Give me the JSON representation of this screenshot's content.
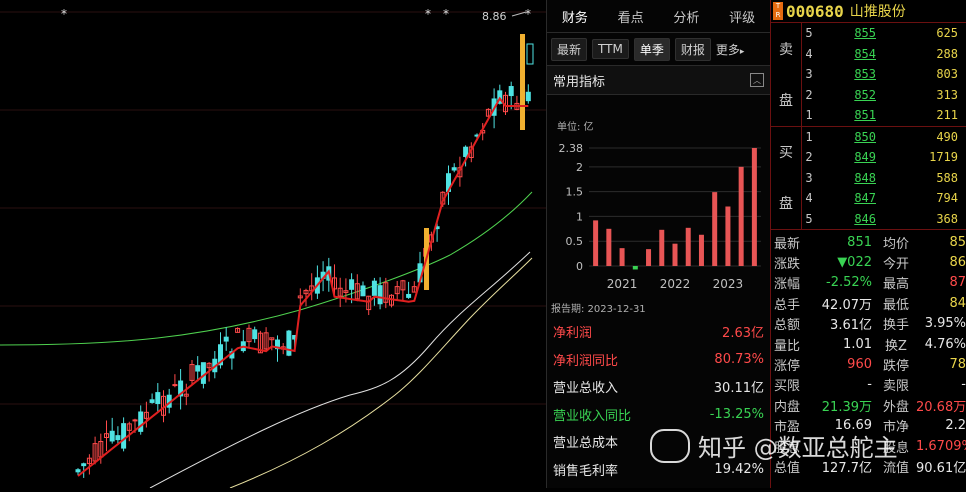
{
  "chart": {
    "price_label": "8.86",
    "markers": [
      "*",
      "*",
      "*",
      "*"
    ]
  },
  "fin": {
    "tabs": [
      "财务",
      "看点",
      "分析",
      "评级"
    ],
    "active_tab": 0,
    "buttons": [
      "最新",
      "TTM",
      "单季",
      "财报",
      "更多"
    ],
    "active_button": 2,
    "section_title": "常用指标",
    "unit_label": "单位: 亿",
    "report_date": "报告期:  2023-12-31",
    "metrics": [
      {
        "label": "净利润",
        "value": "2.63亿",
        "color": "red"
      },
      {
        "label": "净利润同比",
        "value": "80.73%",
        "color": "red"
      },
      {
        "label": "营业总收入",
        "value": "30.11亿",
        "color": "white"
      },
      {
        "label": "营业收入同比",
        "value": "-13.25%",
        "color": "green"
      },
      {
        "label": "营业总成本",
        "value": "",
        "color": "white"
      },
      {
        "label": "销售毛利率",
        "value": "19.42%",
        "color": "white"
      }
    ]
  },
  "chart_data": {
    "type": "bar",
    "ylim": [
      0,
      2.38
    ],
    "yticks": [
      "2.38",
      "2",
      "1.5",
      "1",
      "0.5",
      "0"
    ],
    "xlabels": [
      "2021",
      "2022",
      "2023"
    ],
    "values": [
      0.92,
      0.75,
      0.36,
      -0.07,
      0.34,
      0.73,
      0.45,
      0.77,
      0.63,
      1.49,
      1.2,
      2.0,
      2.38
    ],
    "bar_color": "#e85555",
    "neg_color": "#39d353"
  },
  "quote": {
    "code": "000680",
    "name": "山推股份",
    "sell_label": [
      "卖",
      "盘"
    ],
    "buy_label": [
      "买",
      "盘"
    ],
    "sells": [
      {
        "lvl": "5",
        "price": "855",
        "vol": "625"
      },
      {
        "lvl": "4",
        "price": "854",
        "vol": "288"
      },
      {
        "lvl": "3",
        "price": "853",
        "vol": "803"
      },
      {
        "lvl": "2",
        "price": "852",
        "vol": "313"
      },
      {
        "lvl": "1",
        "price": "851",
        "vol": "211"
      }
    ],
    "buys": [
      {
        "lvl": "1",
        "price": "850",
        "vol": "490"
      },
      {
        "lvl": "2",
        "price": "849",
        "vol": "1719"
      },
      {
        "lvl": "3",
        "price": "848",
        "vol": "588"
      },
      {
        "lvl": "4",
        "price": "847",
        "vol": "794"
      },
      {
        "lvl": "5",
        "price": "846",
        "vol": "368"
      }
    ],
    "stats": [
      {
        "l1": "最新",
        "v1": "851",
        "c1": "green",
        "l2": "均价",
        "v2": "85",
        "c2": "yellow"
      },
      {
        "l1": "涨跌",
        "v1": "▼022",
        "c1": "green",
        "l2": "今开",
        "v2": "86",
        "c2": "yellow"
      },
      {
        "l1": "涨幅",
        "v1": "-2.52%",
        "c1": "green",
        "l2": "最高",
        "v2": "87",
        "c2": "red"
      },
      {
        "l1": "总手",
        "v1": "42.07万",
        "c1": "white",
        "l2": "最低",
        "v2": "84",
        "c2": "yellow"
      },
      {
        "l1": "总额",
        "v1": "3.61亿",
        "c1": "white",
        "l2": "换手",
        "v2": "3.95%",
        "c2": "white"
      },
      {
        "l1": "量比",
        "v1": "1.01",
        "c1": "white",
        "l2": "换Z",
        "v2": "4.76%",
        "c2": "white"
      },
      {
        "l1": "涨停",
        "v1": "960",
        "c1": "red",
        "l2": "跌停",
        "v2": "78",
        "c2": "yellow"
      },
      {
        "l1": "买限",
        "v1": "-",
        "c1": "white",
        "l2": "卖限",
        "v2": "-",
        "c2": "white"
      },
      {
        "l1": "内盘",
        "v1": "21.39万",
        "c1": "green",
        "l2": "外盘",
        "v2": "20.68万",
        "c2": "red"
      },
      {
        "l1": "市盈",
        "v1": "16.69",
        "c1": "white",
        "l2": "市净",
        "v2": "2.2",
        "c2": "white"
      },
      {
        "l1": "股息",
        "v1": "",
        "c1": "white",
        "l2": "股息",
        "v2": "1.6709%",
        "c2": "red"
      },
      {
        "l1": "总值",
        "v1": "127.7亿",
        "c1": "white",
        "l2": "流值",
        "v2": "90.61亿",
        "c2": "white"
      }
    ]
  },
  "watermark": {
    "text": "知乎 @数亚总舵主"
  }
}
